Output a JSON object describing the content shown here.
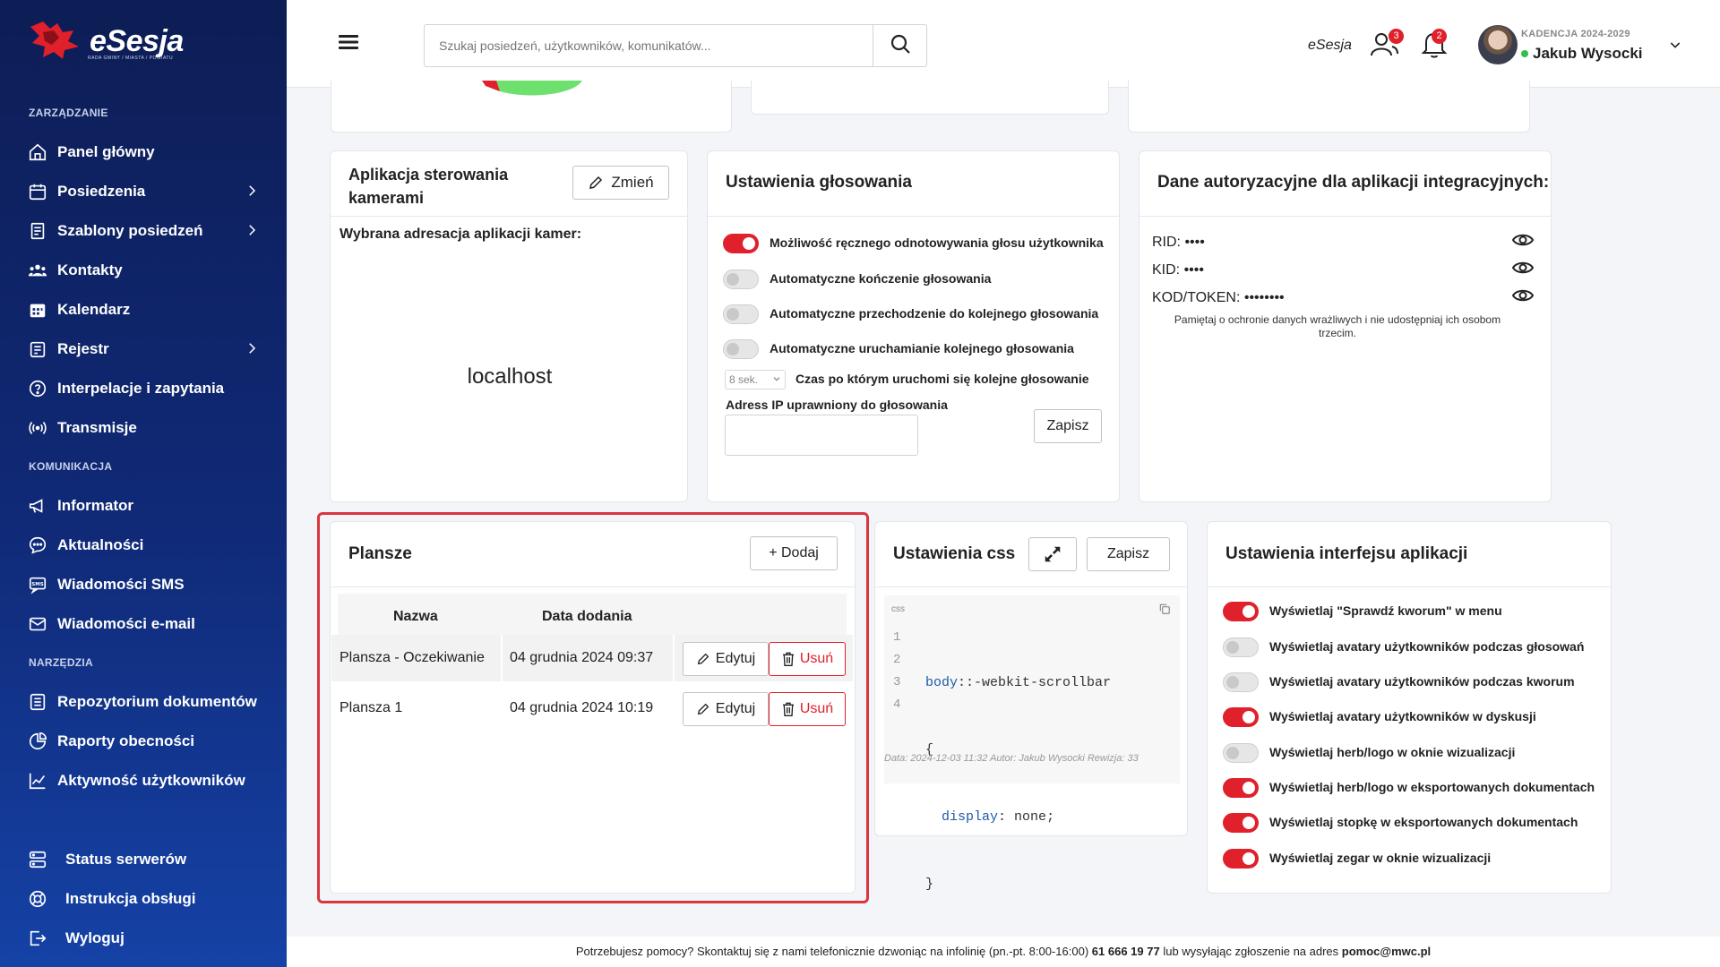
{
  "app": {
    "name": "eSesja",
    "tagline": "RADA GMINY / MIASTA / POWIATU"
  },
  "sidebar": {
    "sections": {
      "management": "ZARZĄDZANIE",
      "communication": "KOMUNIKACJA",
      "tools": "NARZĘDZIA"
    },
    "items": [
      {
        "label": "Panel główny",
        "icon": "home-icon"
      },
      {
        "label": "Posiedzenia",
        "icon": "calendar-icon",
        "expandable": true
      },
      {
        "label": "Szablony posiedzeń",
        "icon": "template-icon",
        "expandable": true
      },
      {
        "label": "Kontakty",
        "icon": "contacts-icon"
      },
      {
        "label": "Kalendarz",
        "icon": "calendar-grid-icon"
      },
      {
        "label": "Rejestr",
        "icon": "register-icon",
        "expandable": true
      },
      {
        "label": "Interpelacje i zapytania",
        "icon": "question-icon"
      },
      {
        "label": "Transmisje",
        "icon": "broadcast-icon"
      },
      {
        "label": "Informator",
        "icon": "megaphone-icon"
      },
      {
        "label": "Aktualności",
        "icon": "chat-icon"
      },
      {
        "label": "Wiadomości SMS",
        "icon": "sms-icon"
      },
      {
        "label": "Wiadomości e-mail",
        "icon": "mail-icon"
      },
      {
        "label": "Repozytorium dokumentów",
        "icon": "document-icon"
      },
      {
        "label": "Raporty obecności",
        "icon": "report-icon"
      },
      {
        "label": "Aktywność użytkowników",
        "icon": "chart-line-icon"
      },
      {
        "label": "Status serwerów",
        "icon": "server-icon"
      },
      {
        "label": "Instrukcja obsługi",
        "icon": "lifebuoy-icon"
      },
      {
        "label": "Wyloguj",
        "icon": "logout-icon"
      }
    ]
  },
  "topbar": {
    "search_placeholder": "Szukaj posiedzeń, użytkowników, komunikatów...",
    "brand": "eSesja",
    "users_badge": "3",
    "notif_badge": "2",
    "user": {
      "term": "KADENCJA 2024-2029",
      "name": "Jakub Wysocki"
    }
  },
  "camera": {
    "title_line1": "Aplikacja sterowania",
    "title_line2": "kamerami",
    "change_label": "Zmień",
    "address_label": "Wybrana adresacja aplikacji kamer:",
    "address_value": "localhost"
  },
  "voting": {
    "title": "Ustawienia głosowania",
    "toggles": [
      {
        "label": "Możliwość ręcznego odnotowywania głosu użytkownika",
        "on": true
      },
      {
        "label": "Automatyczne kończenie głosowania",
        "on": false
      },
      {
        "label": "Automatyczne przechodzenie do kolejnego głosowania",
        "on": false
      },
      {
        "label": "Automatyczne uruchamianie kolejnego głosowania",
        "on": false
      }
    ],
    "delay_value": "8 sek.",
    "delay_label": "Czas po którym uruchomi się kolejne głosowanie",
    "ip_label": "Adress IP uprawniony do głosowania",
    "ip_value": "",
    "save_label": "Zapisz"
  },
  "auth": {
    "title": "Dane autoryzacyjne dla aplikacji integracyjnych:",
    "rows": [
      {
        "label": "RID:",
        "value": "••••"
      },
      {
        "label": "KID:",
        "value": "••••"
      },
      {
        "label": "KOD/TOKEN:",
        "value": "••••••••"
      }
    ],
    "note": "Pamiętaj o ochronie danych wrażliwych i nie udostępniaj ich osobom trzecim."
  },
  "boards": {
    "title": "Plansze",
    "add_label": "+ Dodaj",
    "columns": [
      "Nazwa",
      "Data dodania"
    ],
    "rows": [
      {
        "name": "Plansza - Oczekiwanie",
        "date": "04 grudnia 2024 09:37"
      },
      {
        "name": "Plansza 1",
        "date": "04 grudnia 2024 10:19"
      }
    ],
    "edit_label": "Edytuj",
    "delete_label": "Usuń"
  },
  "css_settings": {
    "title": "Ustawienia css",
    "save_label": "Zapisz",
    "lang": "css",
    "line_numbers": [
      "1",
      "2",
      "3",
      "4"
    ],
    "code": {
      "selector": "body",
      "pseudo": "::-webkit-scrollbar",
      "open": "{",
      "prop": "display",
      "value": "none",
      "close": "}"
    },
    "meta": "Data: 2024-12-03 11:32 Autor: Jakub Wysocki Rewizja: 33"
  },
  "ui_settings": {
    "title": "Ustawienia interfejsu aplikacji",
    "toggles": [
      {
        "label": "Wyświetlaj \"Sprawdź kworum\" w menu",
        "on": true
      },
      {
        "label": "Wyświetlaj avatary użytkowników podczas głosowań",
        "on": false
      },
      {
        "label": "Wyświetlaj avatary użytkowników podczas kworum",
        "on": false
      },
      {
        "label": "Wyświetlaj avatary użytkowników w dyskusji",
        "on": true
      },
      {
        "label": "Wyświetlaj herb/logo w oknie wizualizacji",
        "on": false
      },
      {
        "label": "Wyświetlaj herb/logo w eksportowanych dokumentach",
        "on": true
      },
      {
        "label": "Wyświetlaj stopkę w eksportowanych dokumentach",
        "on": true
      },
      {
        "label": "Wyświetlaj zegar w oknie wizualizacji",
        "on": true
      }
    ]
  },
  "footer": {
    "text": "Potrzebujesz pomocy? Skontaktuj się z nami telefonicznie dzwoniąc na infolinię (pn.-pt. 8:00-16:00)",
    "phone": "61 666 19 77",
    "mid": "lub wysyłając zgłoszenie na adres",
    "email": "pomoc@mwc.pl"
  },
  "colors": {
    "accent": "#e0202a",
    "sidebar": "#102a78",
    "highlight_border": "#d9363e"
  }
}
